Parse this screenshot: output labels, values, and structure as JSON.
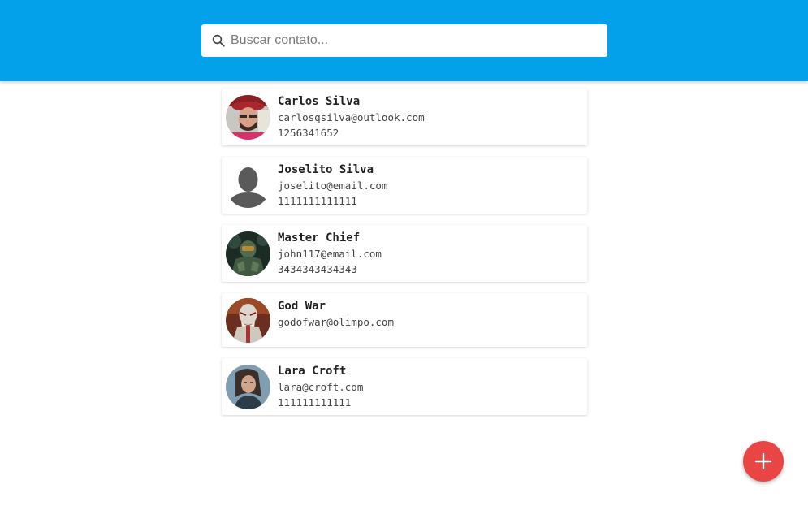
{
  "search": {
    "placeholder": "Buscar contato...",
    "value": ""
  },
  "contacts": [
    {
      "name": "Carlos Silva",
      "email": "carlosqsilva@outlook.com",
      "phone": "1256341652",
      "avatar": "photo-man-cap-icon"
    },
    {
      "name": "Joselito Silva",
      "email": "joselito@email.com",
      "phone": "1111111111111",
      "avatar": "default-person-icon"
    },
    {
      "name": "Master Chief",
      "email": "john117@email.com",
      "phone": "3434343434343",
      "avatar": "photo-armored-soldier-icon"
    },
    {
      "name": "God War",
      "email": "godofwar@olimpo.com",
      "phone": "",
      "avatar": "photo-warrior-icon"
    },
    {
      "name": "Lara Croft",
      "email": "lara@croft.com",
      "phone": "111111111111",
      "avatar": "photo-woman-icon"
    }
  ],
  "fab": {
    "icon": "plus-icon",
    "color": "#ea4545"
  },
  "colors": {
    "header": "#03a1e9",
    "fab": "#ea4545"
  }
}
